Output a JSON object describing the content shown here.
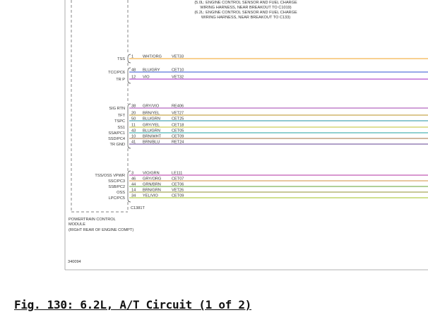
{
  "header_note": [
    "(5.0L: ENGINE CONTROL SENSOR AND FUEL CHARGE",
    "WIRING HARNESS, NEAR BREAKOUT TO C1019)",
    "(6.2L: ENGINE CONTROL SENSOR AND FUEL CHARGE",
    "WIRING HARNESS, NEAR BREAKOUT TO C133)"
  ],
  "groups": [
    {
      "wires": [
        {
          "signal": "TSS",
          "pin": "1",
          "color": "WHT/ORG",
          "circuit": "VET33",
          "line_color": "#f0a020"
        }
      ]
    },
    {
      "wires": [
        {
          "signal": "TCC/PC6",
          "pin": "48",
          "color": "BLU/GRY",
          "circuit": "CET10",
          "line_color": "#3050d0"
        },
        {
          "signal": "TR P",
          "pin": "12",
          "color": "VIO",
          "circuit": "VET32",
          "line_color": "#a020c0"
        }
      ]
    },
    {
      "wires": [
        {
          "signal": "SIG RTN",
          "pin": "38",
          "color": "GRY/VIO",
          "circuit": "RE406",
          "line_color": "#a040b0"
        },
        {
          "signal": "TFT",
          "pin": "20",
          "color": "BRN/YEL",
          "circuit": "VET27",
          "line_color": "#b89020"
        },
        {
          "signal": "TSPC",
          "pin": "50",
          "color": "BLU/GRN",
          "circuit": "CET25",
          "line_color": "#2090a0"
        },
        {
          "signal": "SS1",
          "pin": "11",
          "color": "GRY/YEL",
          "circuit": "CET18",
          "line_color": "#c0c030"
        },
        {
          "signal": "SSA/PC1",
          "pin": "43",
          "color": "BLU/GRN",
          "circuit": "CET05",
          "line_color": "#20a0a0"
        },
        {
          "signal": "SSD/PC4",
          "pin": "10",
          "color": "BRN/WHT",
          "circuit": "CET09",
          "line_color": "#a07040"
        },
        {
          "signal": "TR GND",
          "pin": "41",
          "color": "BRN/BLU",
          "circuit": "RET24",
          "line_color": "#604090"
        }
      ]
    },
    {
      "wires": [
        {
          "signal": "TSS/OSS VPWR",
          "pin": "3",
          "color": "VIO/GRN",
          "circuit": "LE111",
          "line_color": "#b030a0"
        },
        {
          "signal": "SSC/PC3",
          "pin": "46",
          "color": "GRY/ORG",
          "circuit": "CET07",
          "line_color": "#d09040"
        },
        {
          "signal": "SSB/PC2",
          "pin": "44",
          "color": "GRN/BRN",
          "circuit": "CET06",
          "line_color": "#60a030"
        },
        {
          "signal": "OSS",
          "pin": "14",
          "color": "BRN/GRN",
          "circuit": "VET26",
          "line_color": "#909030"
        },
        {
          "signal": "LPC/PC5",
          "pin": "34",
          "color": "YEL/VIO",
          "circuit": "CET09",
          "line_color": "#a0c020"
        }
      ]
    }
  ],
  "connector": "C1381T",
  "module_label": [
    "POWERTRAIN CONTROL",
    "MODULE",
    "(RIGHT REAR OF ENGINE COMPT)"
  ],
  "figure_id": "340094",
  "caption": "Fig. 130: 6.2L, A/T Circuit (1 of 2)"
}
